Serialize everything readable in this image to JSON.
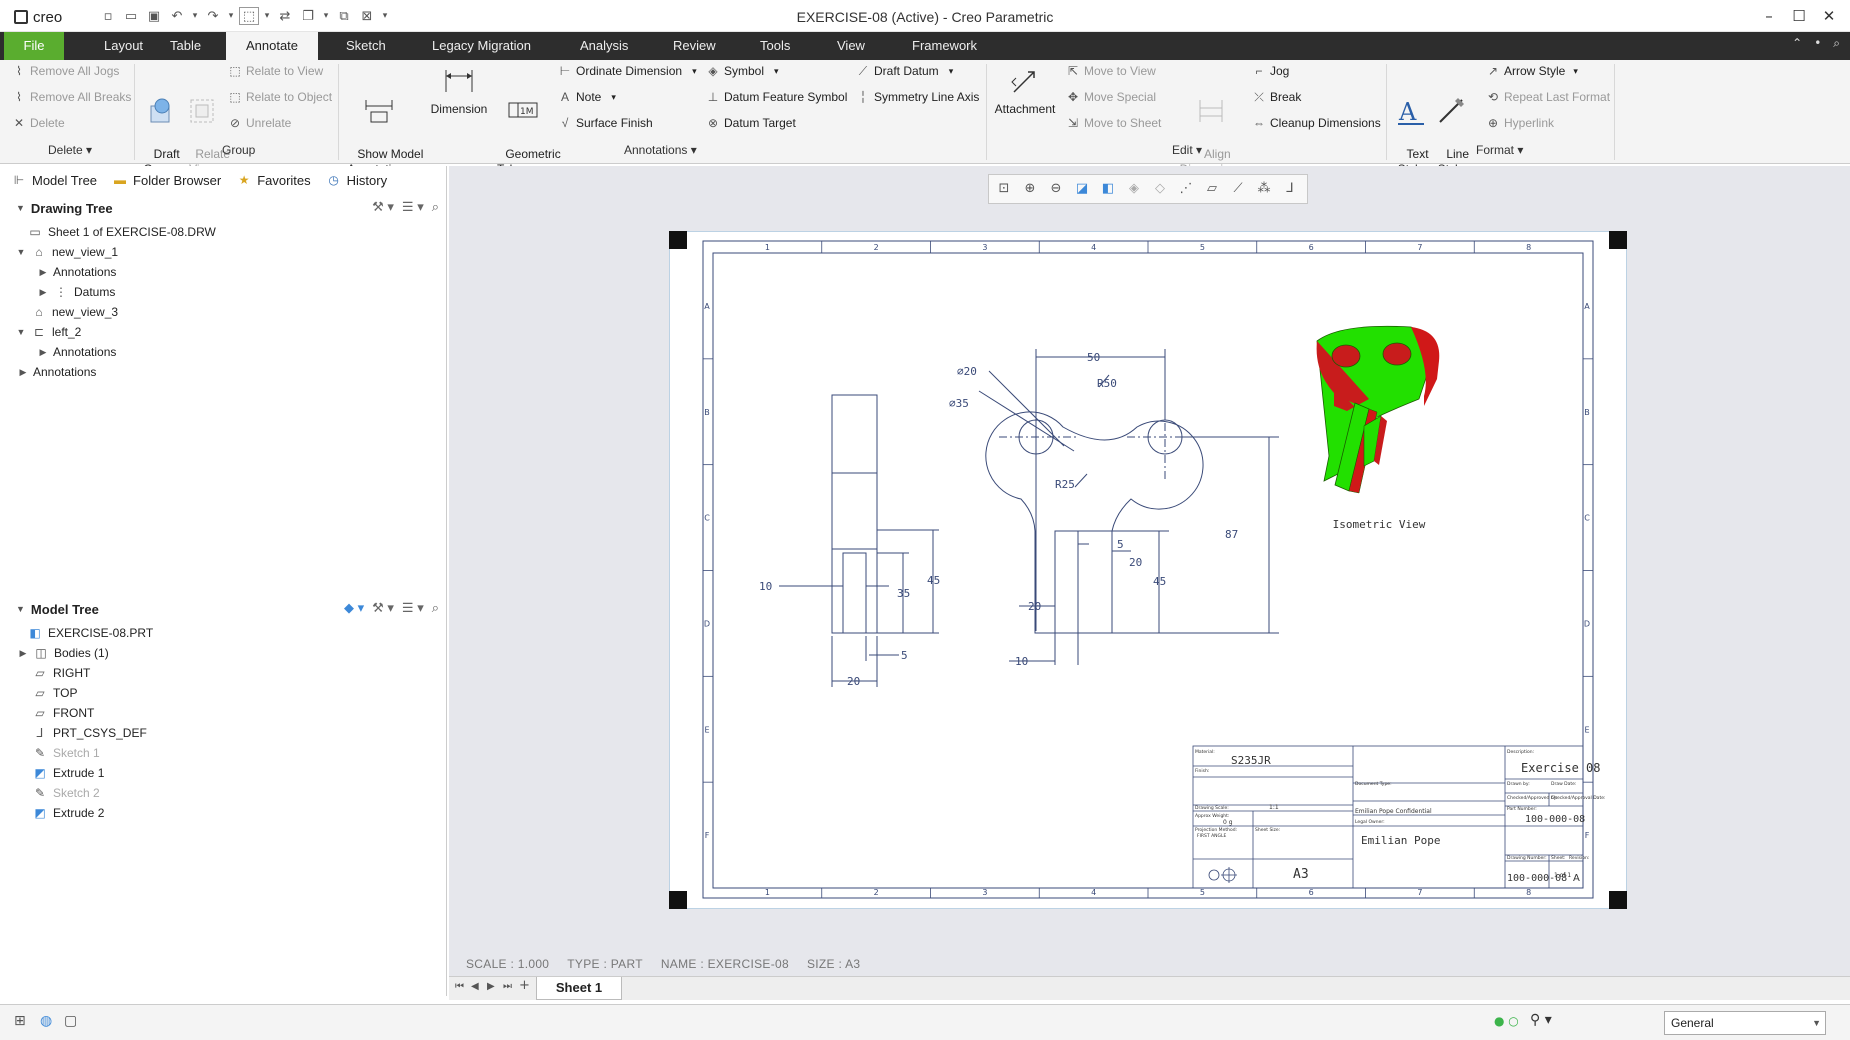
{
  "app": {
    "logo": "creo",
    "title": "EXERCISE-08 (Active) - Creo Parametric"
  },
  "tabs": [
    "File",
    "Layout",
    "Table",
    "Annotate",
    "Sketch",
    "Legacy Migration",
    "Analysis",
    "Review",
    "Tools",
    "View",
    "Framework"
  ],
  "active_tab": "Annotate",
  "ribbon": {
    "delete_group": {
      "remove_all_jogs": "Remove All Jogs",
      "remove_all_breaks": "Remove All Breaks",
      "delete": "Delete",
      "label": "Delete"
    },
    "group_group": {
      "draft_group": "Draft\nGroup",
      "relate_view": "Relate\nView",
      "relate_to_view": "Relate to View",
      "relate_to_object": "Relate to Object",
      "unrelate": "Unrelate",
      "label": "Group"
    },
    "annotations_group": {
      "show_model_annotations": "Show Model\nAnnotations",
      "dimension": "Dimension",
      "geometric_tolerance": "Geometric\nTolerance",
      "ordinate_dimension": "Ordinate Dimension",
      "note": "Note",
      "surface_finish": "Surface Finish",
      "symbol": "Symbol",
      "datum_feature_symbol": "Datum Feature Symbol",
      "datum_target": "Datum Target",
      "draft_datum": "Draft Datum",
      "symmetry_line_axis": "Symmetry Line Axis",
      "label": "Annotations"
    },
    "edit_group": {
      "attachment": "Attachment",
      "move_to_view": "Move to View",
      "move_special": "Move Special",
      "move_to_sheet": "Move to Sheet",
      "align_dimensions": "Align\nDimensions",
      "jog": "Jog",
      "break": "Break",
      "cleanup_dimensions": "Cleanup Dimensions",
      "label": "Edit"
    },
    "format_group": {
      "text_style": "Text\nStyle",
      "line_style": "Line\nStyle",
      "arrow_style": "Arrow Style",
      "repeat_last_format": "Repeat Last Format",
      "hyperlink": "Hyperlink",
      "label": "Format"
    }
  },
  "left_tabs": [
    "Model Tree",
    "Folder Browser",
    "Favorites",
    "History"
  ],
  "drawing_tree": {
    "title": "Drawing Tree",
    "items": [
      {
        "label": "Sheet 1 of EXERCISE-08.DRW"
      },
      {
        "label": "new_view_1"
      },
      {
        "label": "Annotations"
      },
      {
        "label": "Datums"
      },
      {
        "label": "new_view_3"
      },
      {
        "label": "left_2"
      },
      {
        "label": "Annotations"
      },
      {
        "label": "Annotations"
      }
    ]
  },
  "model_tree": {
    "title": "Model Tree",
    "items": [
      {
        "label": "EXERCISE-08.PRT",
        "disabled": false
      },
      {
        "label": "Bodies (1)",
        "disabled": false
      },
      {
        "label": "RIGHT",
        "disabled": false
      },
      {
        "label": "TOP",
        "disabled": false
      },
      {
        "label": "FRONT",
        "disabled": false
      },
      {
        "label": "PRT_CSYS_DEF",
        "disabled": false
      },
      {
        "label": "Sketch 1",
        "disabled": true
      },
      {
        "label": "Extrude 1",
        "disabled": false
      },
      {
        "label": "Sketch 2",
        "disabled": true
      },
      {
        "label": "Extrude 2",
        "disabled": false
      }
    ]
  },
  "drawing": {
    "border_cols": [
      "1",
      "2",
      "3",
      "4",
      "5",
      "6",
      "7",
      "8"
    ],
    "border_rows": [
      "A",
      "B",
      "C",
      "D",
      "E",
      "F"
    ],
    "dims": {
      "side_10": "10",
      "side_35": "35",
      "side_45": "45",
      "side_5": "5",
      "side_20": "20",
      "front_d20": "⌀20",
      "front_d35": "⌀35",
      "front_50": "50",
      "front_r50": "R50",
      "front_r25": "R25",
      "front_87": "87",
      "front_5": "5",
      "front_20a": "20",
      "front_45": "45",
      "front_20b": "20",
      "front_10": "10"
    },
    "iso_label": "Isometric View",
    "title_block": {
      "material_label": "Material:",
      "material": "S235JR",
      "finish_label": "Finish:",
      "description_label": "Description:",
      "description": "Exercise 08",
      "part_number_label": "Part Number:",
      "part_number": "100-000-08",
      "drawing_number_label": "Drawing Number:",
      "drawing_number": "100-000-08",
      "size_label": "Sheet Size:",
      "sheet_size": "A3",
      "revision_label": "Revision:",
      "revision": "A",
      "sheet_label": "Sheet:",
      "sheet": "1 of 1",
      "legal_owner_label": "Legal Owner:",
      "legal_owner": "Emilian Pope",
      "confidential": "Emilian Pope Confidential",
      "scale_label": "Drawing Scale:",
      "scale": "1:1",
      "weight_label": "Approx Weight:",
      "weight": "0 g",
      "projection_label": "Projection Method:",
      "projection": "FIRST ANGLE",
      "drawn_by_label": "Drawn by:",
      "date_label": "Draw Date:",
      "checked_label": "Checked/Approved by:",
      "checked_date_label": "Checked/Approval Date:",
      "doc_type_label": "Document Type:"
    }
  },
  "status": {
    "scale": "SCALE : 1.000",
    "type": "TYPE : PART",
    "name": "NAME : EXERCISE-08",
    "size": "SIZE : A3"
  },
  "sheet_tab": "Sheet 1",
  "filter": "General",
  "colors": {
    "file_tab": "#5aad2f",
    "tab_bar": "#2d2d2d",
    "model_green": "#22e000",
    "model_red": "#d01818",
    "drawing_line": "#3a4a78"
  }
}
